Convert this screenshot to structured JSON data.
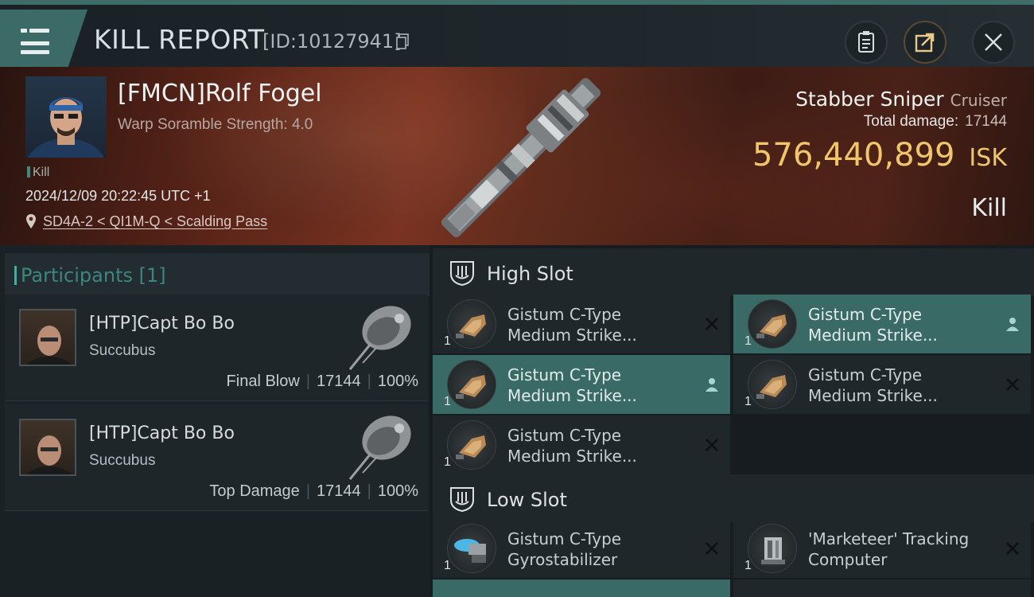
{
  "header": {
    "title": "KILL REPORT",
    "id_text": "[ID:10127941]",
    "icons": [
      "menu-icon",
      "copy-icon",
      "clipboard-icon",
      "share-icon",
      "close-icon"
    ]
  },
  "victim": {
    "name": "[FMCN]Rolf Fogel",
    "subtitle": "Warp Soramble Strength: 4.0",
    "tag": "Kill",
    "datetime": "2024/12/09 20:22:45 UTC +1",
    "location": "SD4A-2 < QI1M-Q < Scalding Pass",
    "ship_name": "Stabber Sniper",
    "ship_class": "Cruiser",
    "total_damage_label": "Total damage:",
    "total_damage": "17144",
    "isk_value": "576,440,899",
    "isk_unit": "ISK",
    "kill_label": "Kill"
  },
  "participants": {
    "label": "Participants",
    "count": "[1]",
    "rows": [
      {
        "name": "[HTP]Capt Bo Bo",
        "ship": "Succubus",
        "role": "Final Blow",
        "damage": "17144",
        "percent": "100%"
      },
      {
        "name": "[HTP]Capt Bo Bo",
        "ship": "Succubus",
        "role": "Top Damage",
        "damage": "17144",
        "percent": "100%"
      }
    ]
  },
  "slots": {
    "high": {
      "label": "High Slot",
      "modules": [
        {
          "qty": "1",
          "line1": "Gistum C-Type",
          "line2": "Medium Strike...",
          "status": "destroyed"
        },
        {
          "qty": "1",
          "line1": "Gistum C-Type",
          "line2": "Medium Strike...",
          "status": "dropped"
        },
        {
          "qty": "1",
          "line1": "Gistum C-Type",
          "line2": "Medium Strike...",
          "status": "dropped"
        },
        {
          "qty": "1",
          "line1": "Gistum C-Type",
          "line2": "Medium Strike...",
          "status": "destroyed"
        },
        {
          "qty": "1",
          "line1": "Gistum C-Type",
          "line2": "Medium Strike...",
          "status": "destroyed"
        }
      ]
    },
    "low": {
      "label": "Low Slot",
      "modules": [
        {
          "qty": "1",
          "line1": "Gistum C-Type",
          "line2": "Gyrostabilizer",
          "status": "destroyed"
        },
        {
          "qty": "1",
          "line1": "'Marketeer' Tracking",
          "line2": "Computer",
          "status": "destroyed"
        }
      ]
    }
  },
  "colors": {
    "accent_teal": "#3a6a66",
    "isk_gold": "#f1c66a"
  }
}
